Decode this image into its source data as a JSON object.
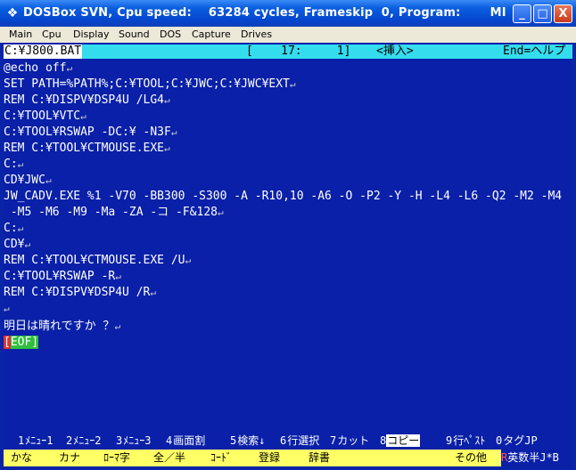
{
  "window": {
    "title": "DOSBox SVN, Cpu speed:    63284 cycles, Frameskip  0, Program:       MI",
    "minimize_label": "_",
    "maximize_label": "□",
    "close_label": "X"
  },
  "menu": [
    "Main",
    "Cpu",
    "Display",
    "Sound",
    "DOS",
    "Capture",
    "Drives"
  ],
  "editor_status": {
    "filename": "C:¥J800.BAT",
    "position": "[    17:     1]",
    "mode": "<挿入>",
    "end_help": "End=ヘルプ"
  },
  "lines": [
    "@echo off",
    "SET PATH=%PATH%;C:¥TOOL;C:¥JWC;C:¥JWC¥EXT",
    "REM C:¥DISPV¥DSP4U /LG4",
    "C:¥TOOL¥VTC",
    "C:¥TOOL¥RSWAP -DC:¥ -N3F",
    "REM C:¥TOOL¥CTMOUSE.EXE",
    "C:",
    "CD¥JWC",
    "JW_CADV.EXE %1 -V70 -BB300 -S300 -A -R10,10 -A6 -O -P2 -Y -H -L4 -L6 -Q2 -M2 -M4",
    " -M5 -M6 -M9 -Ma -ZA -コ -F&128",
    "C:",
    "CD¥",
    "REM C:¥TOOL¥CTMOUSE.EXE /U",
    "C:¥TOOL¥RSWAP -R",
    "REM C:¥DISPV¥DSP4U /R",
    "",
    "明日は晴れですか ？"
  ],
  "line_end_mark": "↵",
  "eof_cursor": "[",
  "eof_text": "EOF]",
  "fkeys": [
    {
      "num": "1",
      "label": "ﾒﾆｭｰ1"
    },
    {
      "num": "2",
      "label": "ﾒﾆｭｰ2"
    },
    {
      "num": "3",
      "label": "ﾒﾆｭｰ3"
    },
    {
      "num": "4",
      "label": "画面割"
    },
    {
      "num": "5",
      "label": "検索↓"
    },
    {
      "num": "6",
      "label": "行選択"
    },
    {
      "num": "7",
      "label": "カット"
    },
    {
      "num": "8",
      "label": "コピー"
    },
    {
      "num": "9",
      "label": "行ﾍﾟｽﾄ"
    },
    {
      "num": "0",
      "label": "タグJP"
    }
  ],
  "bottom_keys": [
    "かな",
    "カナ",
    "ﾛｰﾏ字",
    "全／半",
    "ｺｰﾄﾞ",
    "登録",
    "辞書",
    "その他"
  ],
  "ime_status": {
    "prefix": "R",
    "text": "英数半J*B"
  }
}
